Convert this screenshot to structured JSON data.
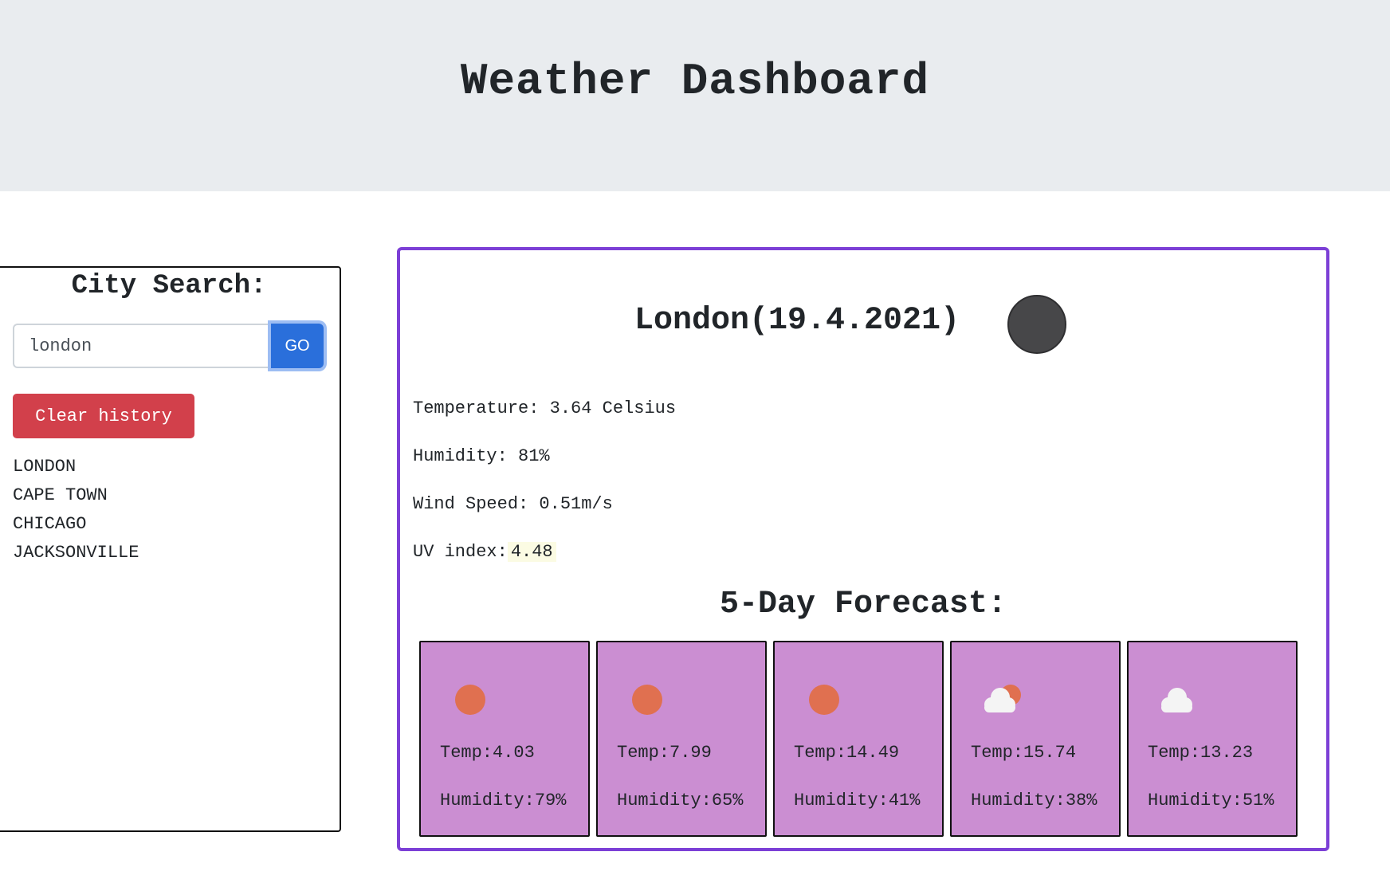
{
  "header": {
    "title": "Weather Dashboard"
  },
  "sidebar": {
    "title": "City Search:",
    "search": {
      "value": "london",
      "placeholder": ""
    },
    "go_label": "GO",
    "clear_label": "Clear history",
    "history": [
      "LONDON",
      "CAPE TOWN",
      "CHICAGO",
      "JACKSONVILLE"
    ]
  },
  "current": {
    "title": "London(19.4.2021)",
    "icon": "night-clear-icon",
    "temperature": "Temperature: 3.64 Celsius",
    "humidity": "Humidity: 81%",
    "wind": "Wind Speed: 0.51m/s",
    "uv_label": "UV index:",
    "uv_value": "4.48"
  },
  "forecast": {
    "title": "5-Day Forecast:",
    "days": [
      {
        "icon": "sun-icon",
        "temp": "Temp:4.03",
        "humidity": "Humidity:79%"
      },
      {
        "icon": "sun-icon",
        "temp": "Temp:7.99",
        "humidity": "Humidity:65%"
      },
      {
        "icon": "sun-icon",
        "temp": "Temp:14.49",
        "humidity": "Humidity:41%"
      },
      {
        "icon": "partly-cloudy-icon",
        "temp": "Temp:15.74",
        "humidity": "Humidity:38%"
      },
      {
        "icon": "cloud-icon",
        "temp": "Temp:13.23",
        "humidity": "Humidity:51%"
      }
    ]
  },
  "colors": {
    "accent": "#7c3fd6",
    "card": "#cb8ed2",
    "go": "#2a6fdb",
    "clear": "#d2404b",
    "sun": "#e07050"
  }
}
